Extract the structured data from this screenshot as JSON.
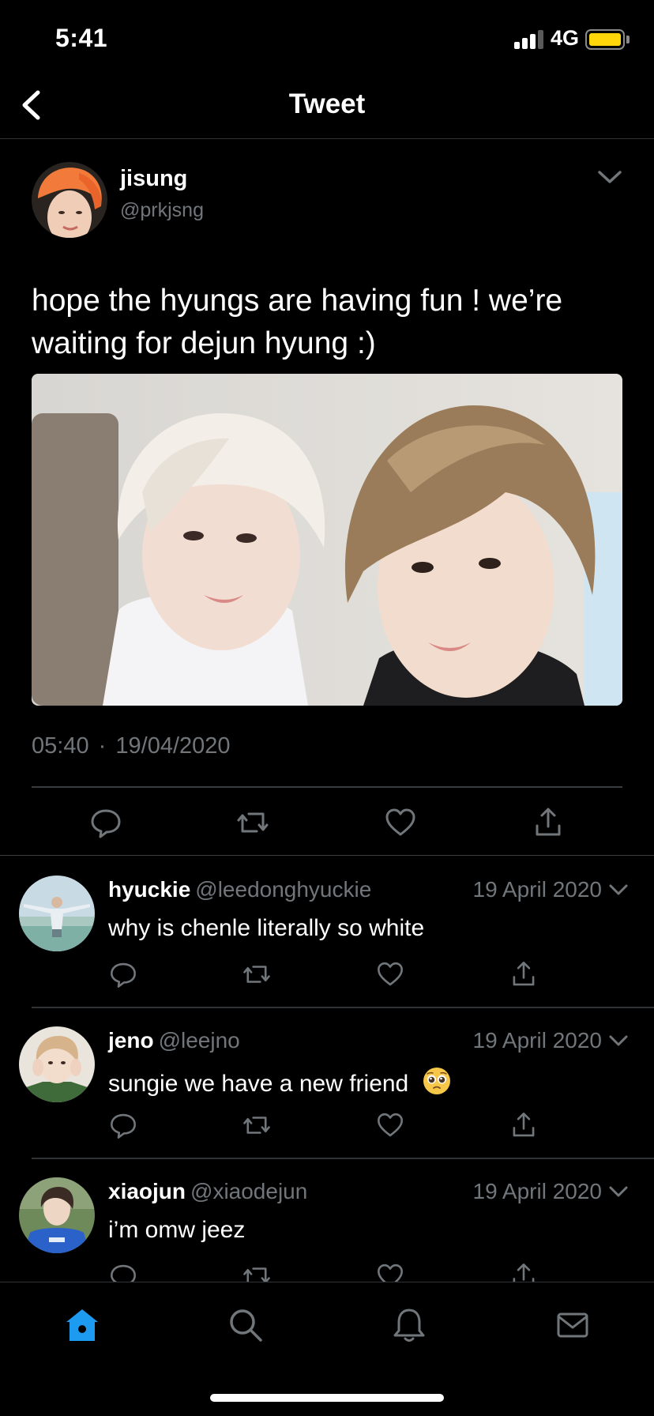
{
  "status_bar": {
    "time": "5:41",
    "network": "4G"
  },
  "header": {
    "title": "Tweet"
  },
  "tweet": {
    "author_name": "jisung",
    "author_handle": "@prkjsng",
    "text": "hope the hyungs are having fun ! we’re waiting for dejun hyung :)",
    "time": "05:40",
    "date": "19/04/2020",
    "separator": "·"
  },
  "replies": [
    {
      "name": "hyuckie",
      "handle": "@leedonghyuckie",
      "date": "19 April 2020",
      "text": "why is chenle literally so white",
      "emoji": ""
    },
    {
      "name": "jeno",
      "handle": "@leejno",
      "date": "19 April 2020",
      "text": "sungie we have a new friend",
      "emoji": "🥺"
    },
    {
      "name": "xiaojun",
      "handle": "@xiaodejun",
      "date": "19 April 2020",
      "text": "i’m omw jeez",
      "emoji": ""
    }
  ],
  "tabs": [
    "home-icon",
    "search-icon",
    "bell-icon",
    "mail-icon"
  ],
  "colors": {
    "accent": "#1d9bf0",
    "muted": "#71767b",
    "background": "#000000",
    "battery": "#ffd60a"
  }
}
